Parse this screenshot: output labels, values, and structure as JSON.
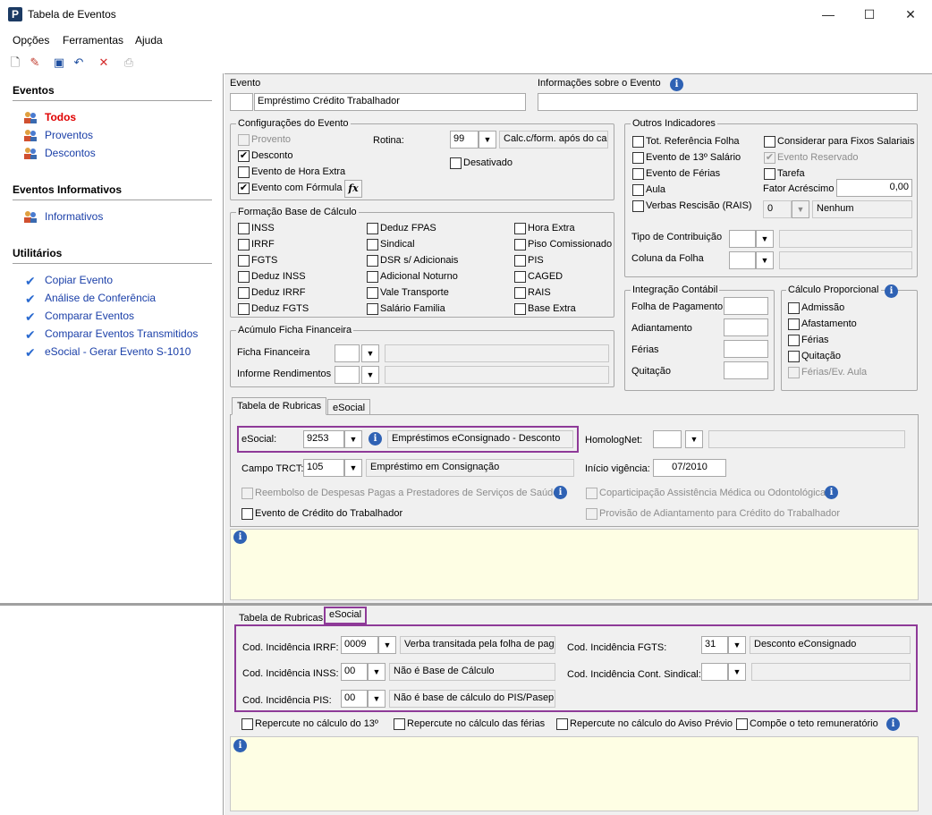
{
  "window": {
    "title": "Tabela de Eventos",
    "app_icon": "P",
    "minimize": "—",
    "maximize": "☐",
    "close": "✕"
  },
  "menu": [
    {
      "label": "Opções"
    },
    {
      "label": "Ferramentas"
    },
    {
      "label": "Ajuda"
    }
  ],
  "sidebar": {
    "eventos_title": "Eventos",
    "eventos": [
      {
        "label": "Todos",
        "active": true
      },
      {
        "label": "Proventos"
      },
      {
        "label": "Descontos"
      }
    ],
    "informativos_title": "Eventos Informativos",
    "informativos": [
      {
        "label": "Informativos"
      }
    ],
    "utilitarios_title": "Utilitários",
    "utilitarios": [
      {
        "label": "Copiar Evento"
      },
      {
        "label": "Análise de Conferência"
      },
      {
        "label": "Comparar Eventos"
      },
      {
        "label": "Comparar Eventos Transmitidos"
      },
      {
        "label": "eSocial - Gerar Evento S-1010"
      }
    ]
  },
  "evento": {
    "label": "Evento",
    "code": "",
    "name": "Empréstimo Crédito Trabalhador",
    "info_label": "Informações sobre o Evento",
    "info_value": ""
  },
  "config": {
    "title": "Configurações do Evento",
    "provento": "Provento",
    "desconto": "Desconto",
    "hora_extra": "Evento de Hora Extra",
    "formula": "Evento com Fórmula",
    "fx": "fx",
    "rotina_label": "Rotina:",
    "rotina_value": "99",
    "rotina_desc": "Calc.c/form. após do cal",
    "desativado": "Desativado"
  },
  "outros": {
    "title": "Outros Indicadores",
    "items_left": [
      "Tot. Referência Folha",
      "Evento de 13º Salário",
      "Evento de Férias",
      "Aula",
      "Verbas Rescisão (RAIS)"
    ],
    "items_right": [
      "Considerar para Fixos Salariais",
      "Evento Reservado",
      "Tarefa"
    ],
    "fator_label": "Fator Acréscimo",
    "fator_value": "0,00",
    "rais_code": "0",
    "rais_desc": "Nenhum",
    "tipo_contrib": "Tipo de Contribuição",
    "coluna_folha": "Coluna da Folha"
  },
  "base": {
    "title": "Formação Base de Cálculo",
    "col1": [
      "INSS",
      "IRRF",
      "FGTS",
      "Deduz INSS",
      "Deduz IRRF",
      "Deduz FGTS"
    ],
    "col2": [
      "Deduz FPAS",
      "Sindical",
      "DSR s/ Adicionais",
      "Adicional Noturno",
      "Vale Transporte",
      "Salário Familia"
    ],
    "col3": [
      "Hora Extra",
      "Piso Comissionado",
      "PIS",
      "CAGED",
      "RAIS",
      "Base Extra"
    ]
  },
  "acumulo": {
    "title": "Acúmulo Ficha Financeira",
    "ficha": "Ficha Financeira",
    "informe": "Informe Rendimentos"
  },
  "integracao": {
    "title": "Integração Contábil",
    "items": [
      "Folha de Pagamento",
      "Adiantamento",
      "Férias",
      "Quitação"
    ]
  },
  "proporcional": {
    "title": "Cálculo Proporcional",
    "items": [
      "Admissão",
      "Afastamento",
      "Férias",
      "Quitação",
      "Férias/Ev. Aula"
    ]
  },
  "tabs1": {
    "tab1": "Tabela de Rubricas",
    "tab2": "eSocial"
  },
  "rubricas": {
    "esocial_label": "eSocial:",
    "esocial_code": "9253",
    "esocial_desc": "Empréstimos eConsignado - Desconto",
    "homolognet_label": "HomologNet:",
    "trct_label": "Campo TRCT:",
    "trct_code": "105",
    "trct_desc": "Empréstimo em Consignação",
    "vigencia_label": "Início vigência:",
    "vigencia_value": "07/2010",
    "reembolso": "Reembolso de Despesas Pagas a Prestadores de Serviços de Saúde",
    "coparticipacao": "Coparticipação Assistência Médica ou Odontológica",
    "credito": "Evento de Crédito do Trabalhador",
    "provisao": "Provisão de Adiantamento para Crédito do Trabalhador"
  },
  "tabs2": {
    "tab1": "Tabela de Rubricas",
    "tab2": "eSocial"
  },
  "esocial": {
    "irrf_label": "Cod. Incidência IRRF:",
    "irrf_code": "0009",
    "irrf_desc": "Verba transitada pela folha de paga",
    "inss_label": "Cod. Incidência INSS:",
    "inss_code": "00",
    "inss_desc": "Não é Base de Cálculo",
    "pis_label": "Cod. Incidência PIS:",
    "pis_code": "00",
    "pis_desc": "Não é base de cálculo do PIS/Pasep",
    "fgts_label": "Cod. Incidência FGTS:",
    "fgts_code": "31",
    "fgts_desc": "Desconto eConsignado",
    "sindical_label": "Cod. Incidência Cont. Sindical:",
    "rep13": "Repercute no cálculo do 13º",
    "repferias": "Repercute no cálculo das férias",
    "repaviso": "Repercute no cálculo do Aviso Prévio",
    "teto": "Compõe o teto remuneratório"
  }
}
